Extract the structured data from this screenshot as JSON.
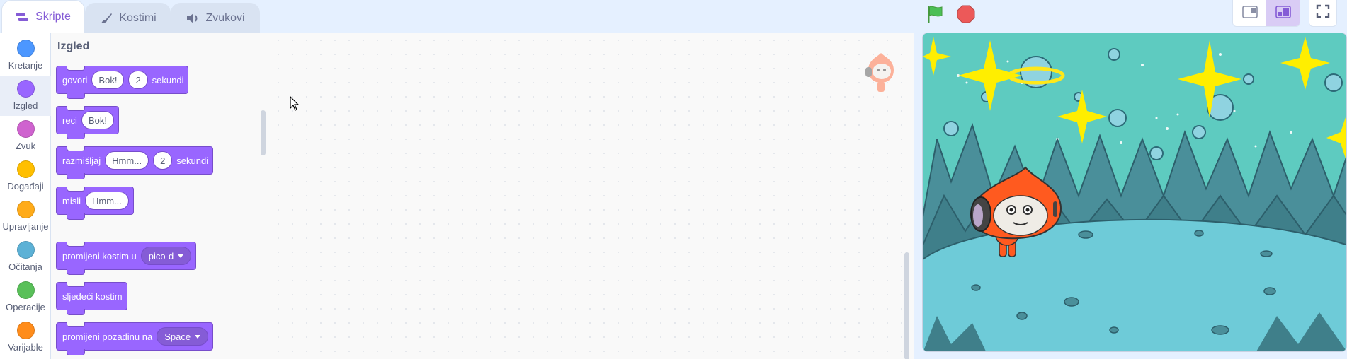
{
  "tabs": [
    {
      "label": "Skripte",
      "icon": "code-icon",
      "active": true
    },
    {
      "label": "Kostimi",
      "icon": "paintbrush-icon",
      "active": false
    },
    {
      "label": "Zvukovi",
      "icon": "speaker-icon",
      "active": false
    }
  ],
  "categories": [
    {
      "label": "Kretanje",
      "color": "#4c97ff"
    },
    {
      "label": "Izgled",
      "color": "#9966ff",
      "selected": true
    },
    {
      "label": "Zvuk",
      "color": "#cf63cf"
    },
    {
      "label": "Događaji",
      "color": "#ffbf00"
    },
    {
      "label": "Upravljanje",
      "color": "#ffab19"
    },
    {
      "label": "Očitanja",
      "color": "#5cb1d6"
    },
    {
      "label": "Operacije",
      "color": "#59c059"
    },
    {
      "label": "Varijable",
      "color": "#ff8c1a"
    }
  ],
  "palette": {
    "title": "Izgled",
    "blocks": {
      "say_for": {
        "text1": "govori",
        "input1": "Bok!",
        "input2": "2",
        "text2": "sekundi"
      },
      "say": {
        "text1": "reci",
        "input1": "Bok!"
      },
      "think_for": {
        "text1": "razmišljaj",
        "input1": "Hmm...",
        "input2": "2",
        "text2": "sekundi"
      },
      "think": {
        "text1": "misli",
        "input1": "Hmm..."
      },
      "switch_costume": {
        "text1": "promijeni kostim u",
        "dropdown": "pico-d"
      },
      "next_costume": {
        "text1": "sljedeći kostim"
      },
      "switch_backdrop": {
        "text1": "promijeni pozadinu na",
        "dropdown": "Space"
      }
    }
  },
  "colors": {
    "looks_block": "#9966ff",
    "accent": "#855cd6",
    "flag": "#4cbf56",
    "stop": "#ec5959"
  },
  "stage": {
    "backdrop": "Space",
    "sprite": "pico"
  }
}
